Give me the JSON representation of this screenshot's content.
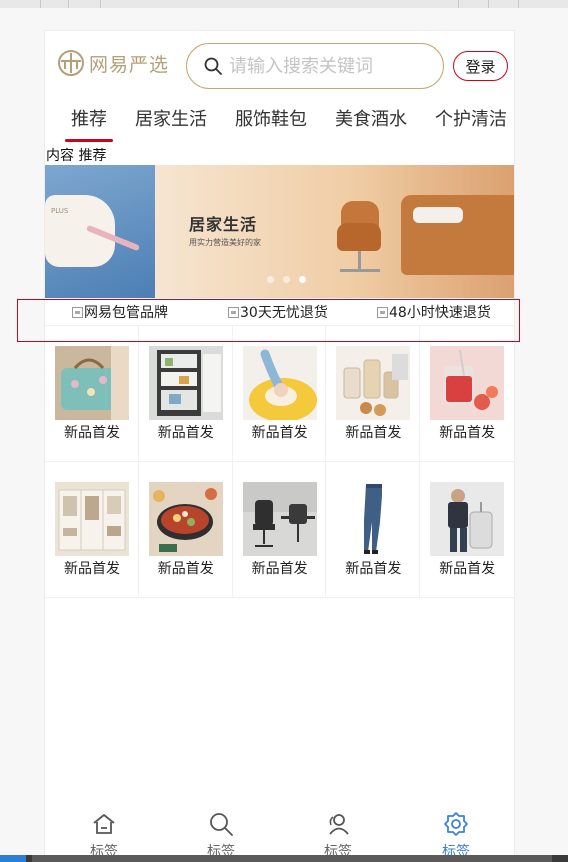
{
  "header": {
    "logo_text": "网易严选",
    "search_placeholder": "请输入搜索关键词",
    "login_label": "登录"
  },
  "tabs": [
    "推荐",
    "居家生活",
    "服饰鞋包",
    "美食酒水",
    "个护清洁"
  ],
  "section_label": "内容 推荐",
  "banner": {
    "title": "居家生活",
    "subtitle": "用实力营造美好的家",
    "bag_text": "PLUS"
  },
  "promises": [
    "网易包管品牌",
    "30天无忧退货",
    "48小时快速退货"
  ],
  "grid": {
    "rows": [
      [
        "新品首发",
        "新品首发",
        "新品首发",
        "新品首发",
        "新品首发"
      ],
      [
        "新品首发",
        "新品首发",
        "新品首发",
        "新品首发",
        "新品首发"
      ]
    ],
    "thumbnails": [
      [
        "bag-photo",
        "fridge-photo",
        "dough-photo",
        "jars-photo",
        "drink-photo"
      ],
      [
        "wardrobe-photo",
        "hotpot-photo",
        "office-chair-photo",
        "jeans-photo",
        "suitcase-photo"
      ]
    ]
  },
  "tabbar": [
    {
      "label": "标签",
      "icon": "home-icon"
    },
    {
      "label": "标签",
      "icon": "search-icon"
    },
    {
      "label": "标签",
      "icon": "user-icon"
    },
    {
      "label": "标签",
      "icon": "settings-icon"
    }
  ],
  "colors": {
    "accent_red": "#d0021b",
    "logo_gold": "#b4a078",
    "search_border": "#c9a66b",
    "tabbar_active": "#3b82d6"
  }
}
